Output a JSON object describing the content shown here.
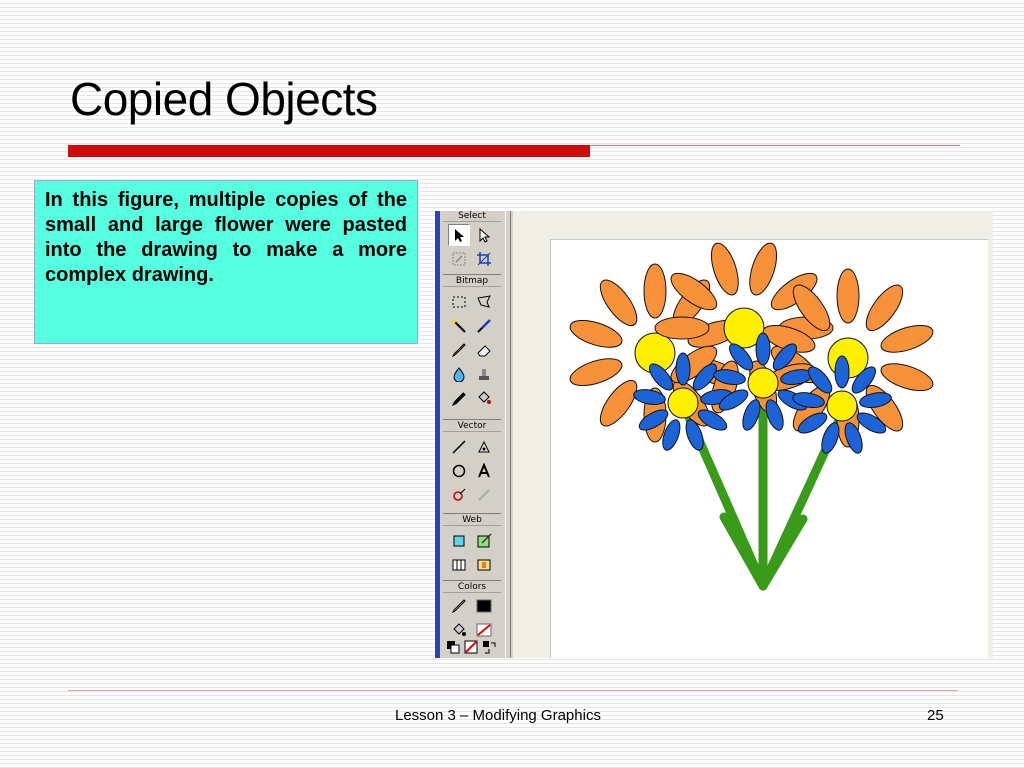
{
  "slide": {
    "title": "Copied Objects",
    "caption": "In this figure, multiple copies of the small and large flower were pasted into the drawing to make a more complex drawing.",
    "footer_title": "Lesson 3 – Modifying Graphics",
    "page_number": "25"
  },
  "toolbar": {
    "sections": [
      {
        "label": "Select",
        "tools": [
          "pointer-tool",
          "subselection-tool",
          "scale-tool",
          "crop-tool"
        ]
      },
      {
        "label": "Bitmap",
        "tools": [
          "marquee-tool",
          "lasso-tool",
          "magic-wand-tool",
          "brush-tool",
          "pencil-tool",
          "eraser-tool",
          "blur-tool",
          "rubber-stamp-tool",
          "eyedropper-tool",
          "paint-bucket-tool"
        ]
      },
      {
        "label": "Vector",
        "tools": [
          "line-tool",
          "pen-tool",
          "ellipse-tool",
          "text-tool",
          "freeform-tool",
          "knife-tool"
        ]
      },
      {
        "label": "Web",
        "tools": [
          "hotspot-tool",
          "slice-tool",
          "hide-slices-button",
          "show-slices-button"
        ]
      },
      {
        "label": "Colors",
        "tools": [
          "stroke-color",
          "fill-color",
          "default-colors",
          "no-color",
          "swap-colors"
        ]
      }
    ]
  },
  "colors": {
    "title_bar": "#d10a0a",
    "caption_bg": "#55ffe0",
    "petal_orange": "#f7913a",
    "petal_blue": "#1d63d8",
    "flower_center": "#fff000",
    "stem_green": "#3a9a1a"
  }
}
